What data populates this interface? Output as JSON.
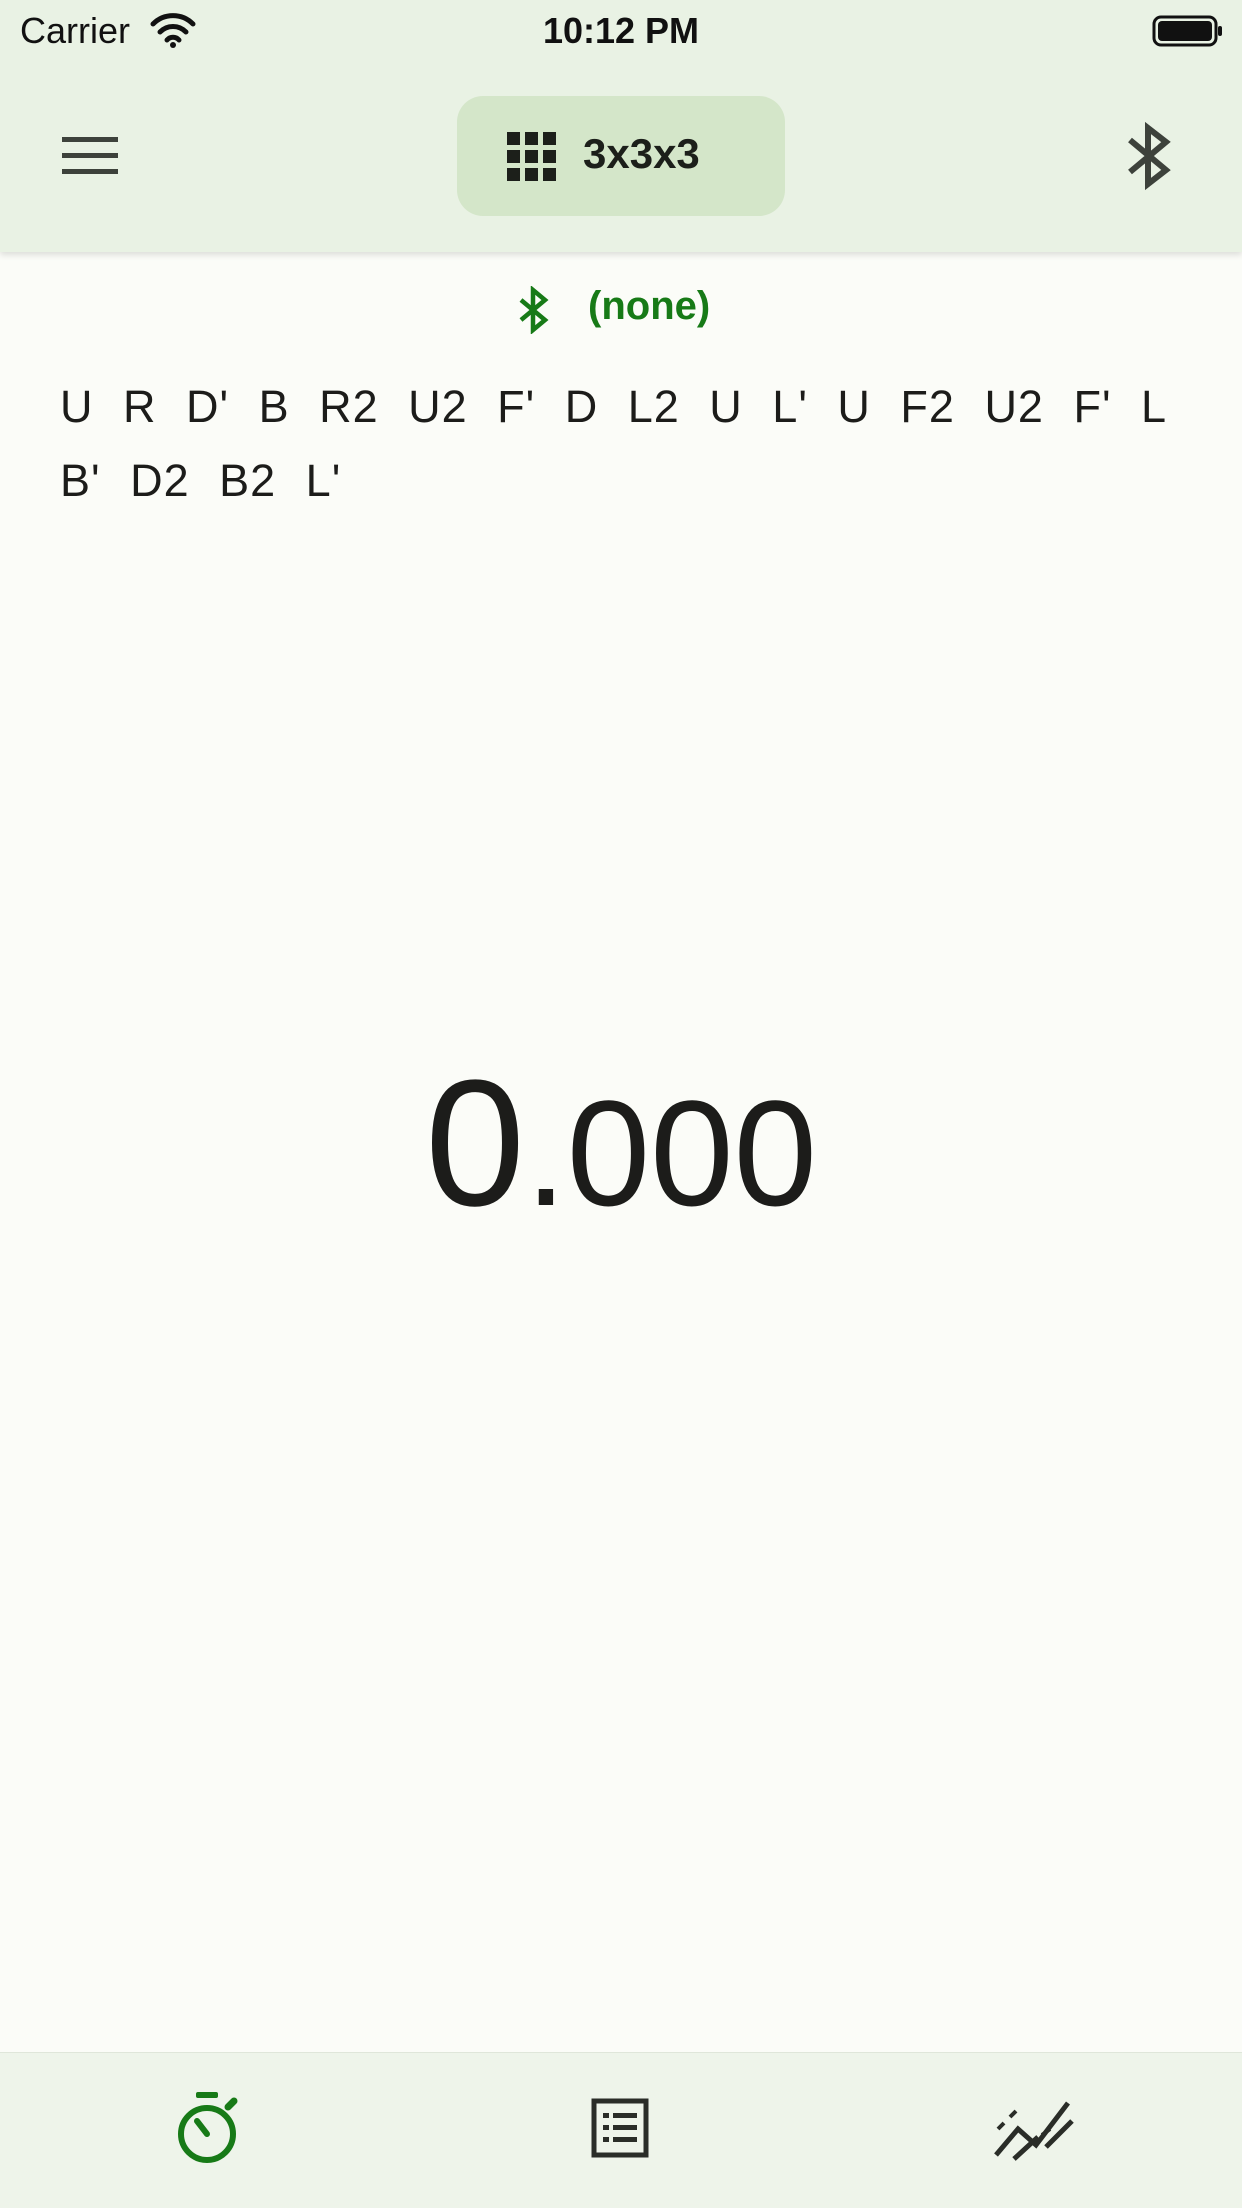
{
  "status_bar": {
    "carrier": "Carrier",
    "time": "10:12 PM"
  },
  "app_bar": {
    "menu_icon": "hamburger-menu-icon",
    "puzzle_icon": "grid-icon",
    "puzzle_label": "3x3x3",
    "bluetooth_icon": "bluetooth-icon"
  },
  "connection": {
    "icon": "bluetooth-icon",
    "label": "(none)"
  },
  "scramble": {
    "text": "U R D' B R2 U2 F' D L2 U L' U F2 U2 F' L B' D2 B2 L'"
  },
  "timer": {
    "whole": "0",
    "fraction": ".000"
  },
  "bottom_nav": {
    "items": [
      {
        "icon": "stopwatch-icon",
        "active": true
      },
      {
        "icon": "list-icon",
        "active": false
      },
      {
        "icon": "trend-chart-icon",
        "active": false
      }
    ]
  },
  "colors": {
    "accent": "#177a17",
    "app_bar_bg": "#e9f2e4",
    "selector_bg": "#d4e6c9",
    "page_bg": "#fbfcf8",
    "nav_bg": "#eef4ea"
  }
}
